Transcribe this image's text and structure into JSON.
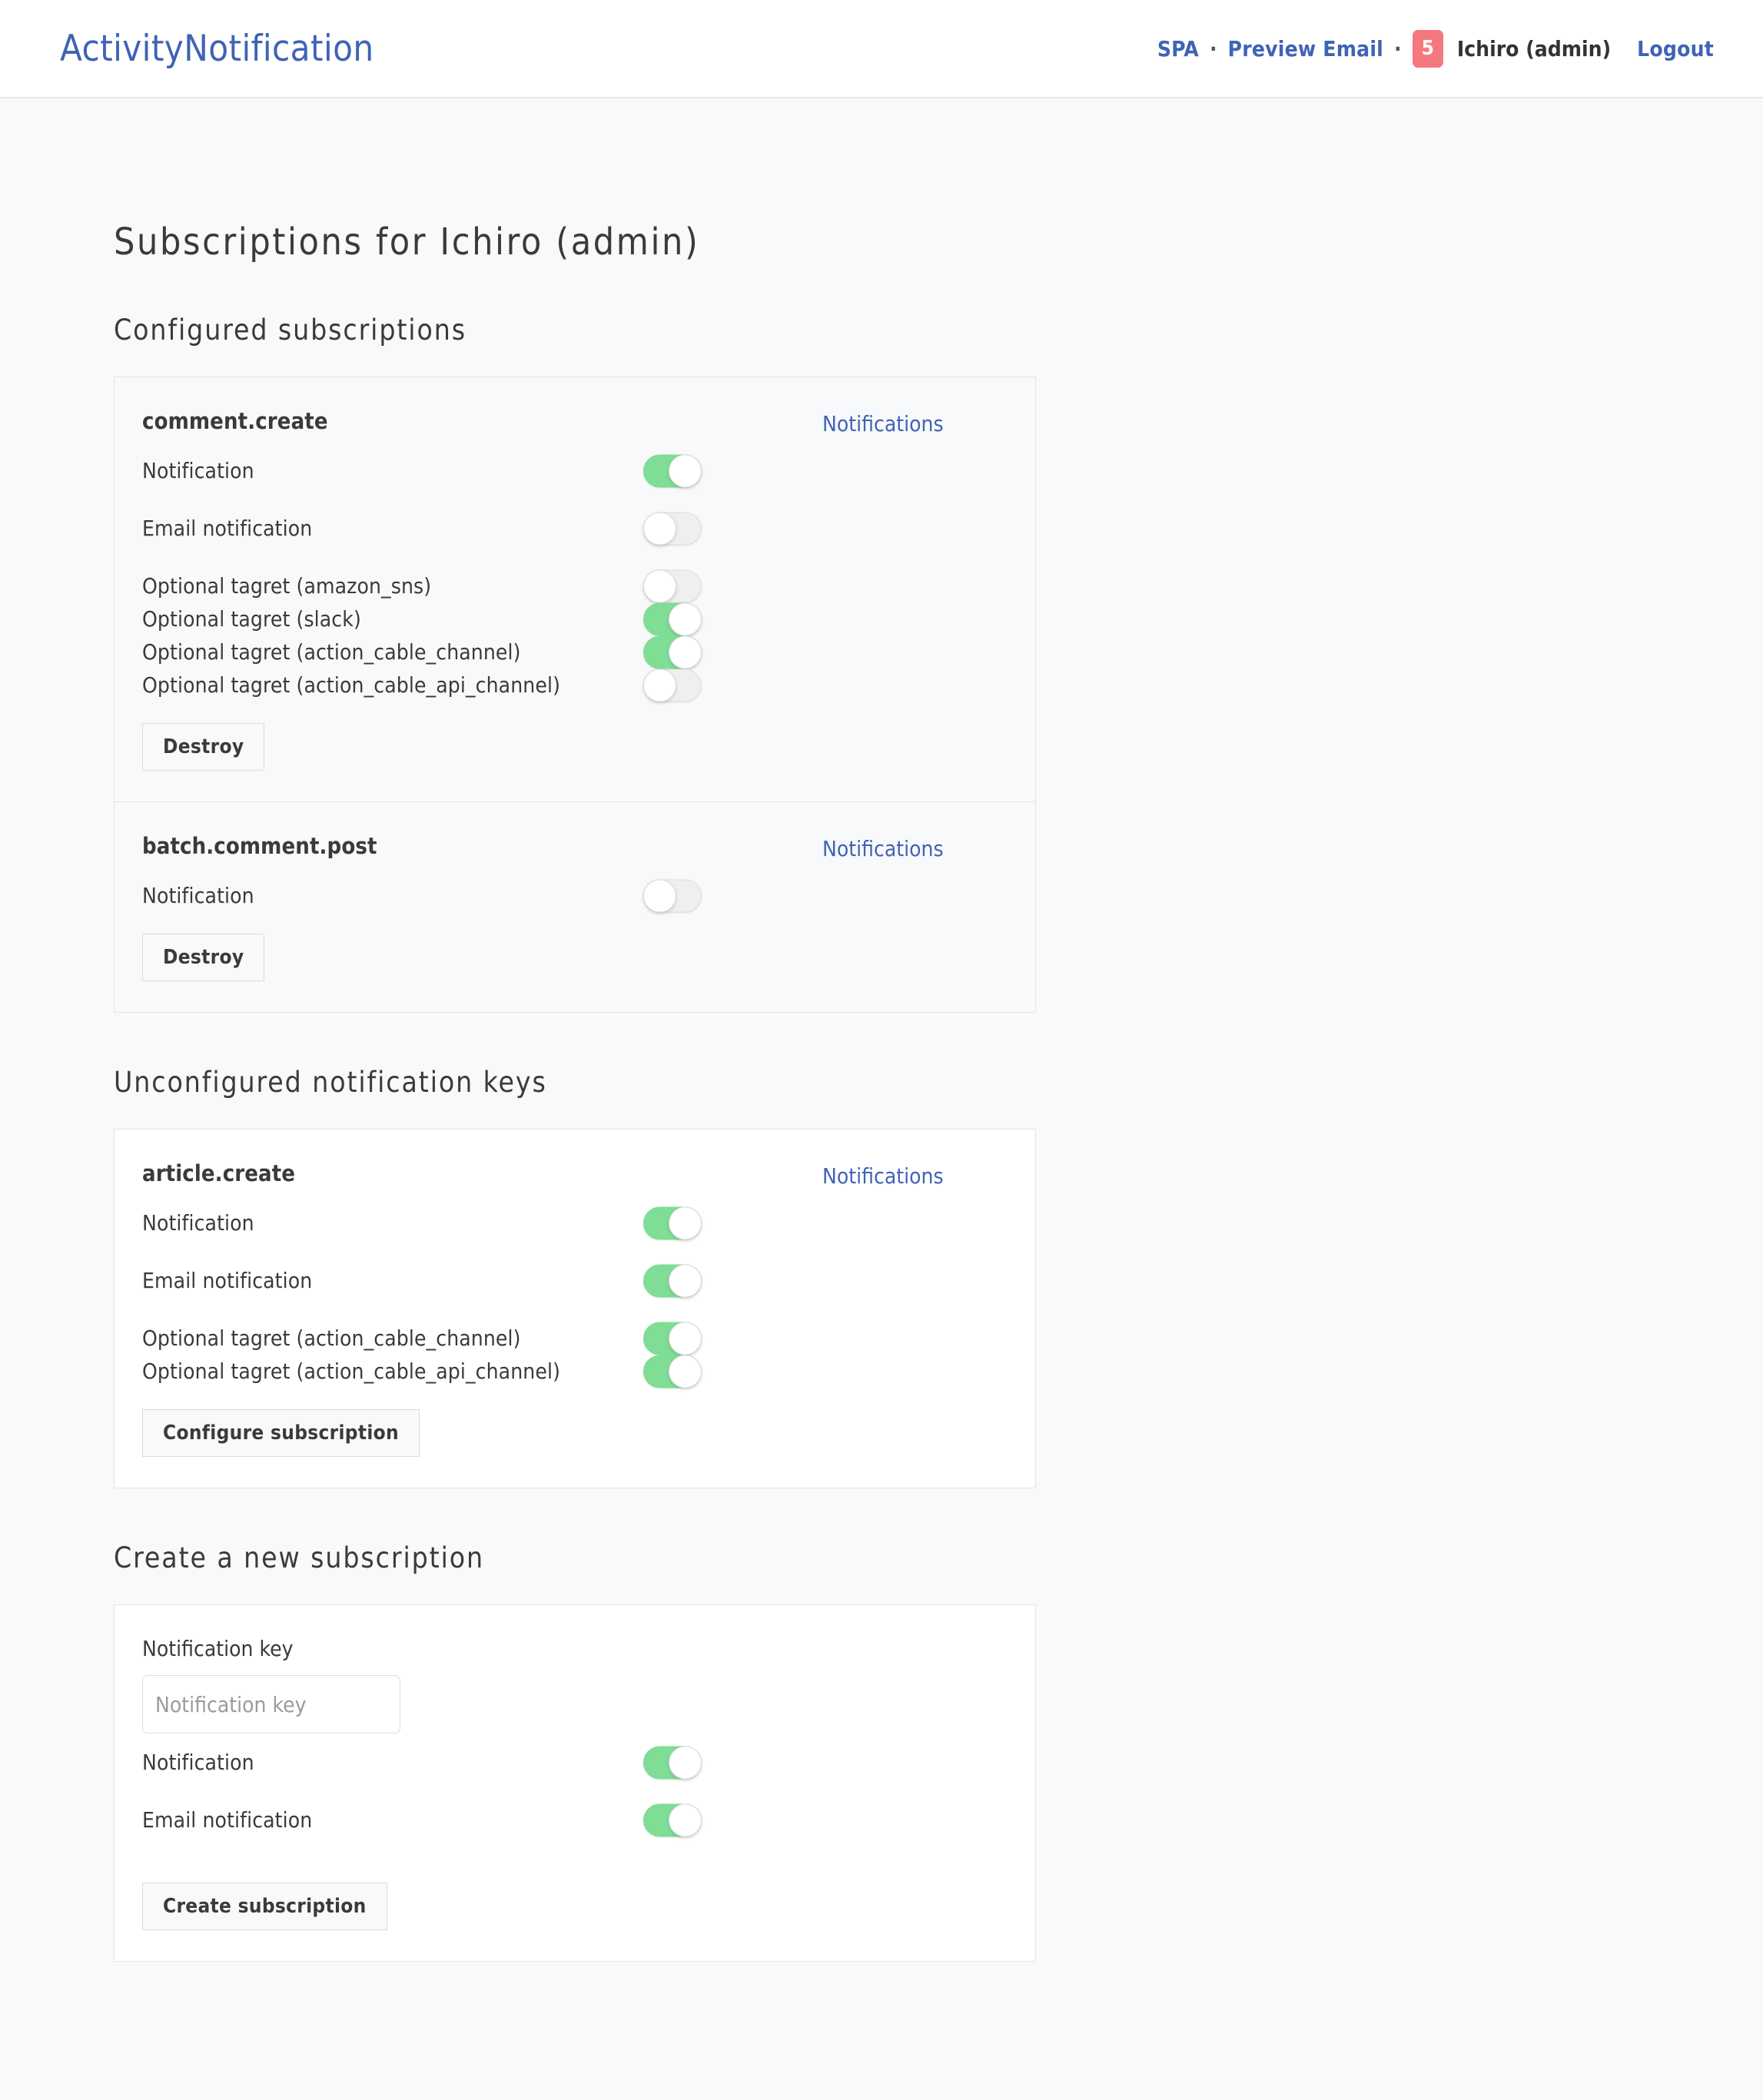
{
  "navbar": {
    "brand": "ActivityNotification",
    "links": [
      {
        "label": "SPA"
      },
      {
        "label": "Preview Email"
      }
    ],
    "separator": "·",
    "badge_count": "5",
    "user": "Ichiro (admin)",
    "logout": "Logout",
    "badge_color": "#f5787e",
    "link_color": "#3f63b5"
  },
  "page": {
    "title": "Subscriptions for Ichiro (admin)",
    "sections": {
      "configured": "Configured subscriptions",
      "unconfigured": "Unconfigured notification keys",
      "create": "Create a new subscription"
    }
  },
  "labels": {
    "notification": "Notification",
    "email_notification": "Email notification",
    "notifications_link": "Notifications",
    "destroy": "Destroy",
    "configure_subscription": "Configure subscription",
    "create_subscription": "Create subscription",
    "notification_key": "Notification key"
  },
  "configured_subscriptions": [
    {
      "key": "comment.create",
      "notifications_link": "Notifications",
      "rows": [
        {
          "label": "Notification",
          "on": true,
          "spaced": true
        },
        {
          "label": "Email notification",
          "on": false,
          "spaced": true
        },
        {
          "label": "Optional tagret (amazon_sns)",
          "on": false,
          "spaced": false
        },
        {
          "label": "Optional tagret (slack)",
          "on": true,
          "spaced": false
        },
        {
          "label": "Optional tagret (action_cable_channel)",
          "on": true,
          "spaced": false
        },
        {
          "label": "Optional tagret (action_cable_api_channel)",
          "on": false,
          "spaced": false
        }
      ],
      "button": "Destroy"
    },
    {
      "key": "batch.comment.post",
      "notifications_link": "Notifications",
      "rows": [
        {
          "label": "Notification",
          "on": false,
          "spaced": false
        }
      ],
      "button": "Destroy"
    }
  ],
  "unconfigured_keys": [
    {
      "key": "article.create",
      "notifications_link": "Notifications",
      "rows": [
        {
          "label": "Notification",
          "on": true,
          "spaced": true
        },
        {
          "label": "Email notification",
          "on": true,
          "spaced": true
        },
        {
          "label": "Optional tagret (action_cable_channel)",
          "on": true,
          "spaced": false
        },
        {
          "label": "Optional tagret (action_cable_api_channel)",
          "on": true,
          "spaced": false
        }
      ],
      "button": "Configure subscription"
    }
  ],
  "new_subscription": {
    "field_label": "Notification key",
    "field_placeholder": "Notification key",
    "field_value": "",
    "rows": [
      {
        "label": "Notification",
        "on": true,
        "spaced": true
      },
      {
        "label": "Email notification",
        "on": true,
        "spaced": true
      }
    ],
    "button": "Create subscription"
  },
  "colors": {
    "toggle_on": "#7fdd95",
    "toggle_off": "#efefef",
    "link": "#3f63b5",
    "page_bg": "#f8f9fa"
  }
}
